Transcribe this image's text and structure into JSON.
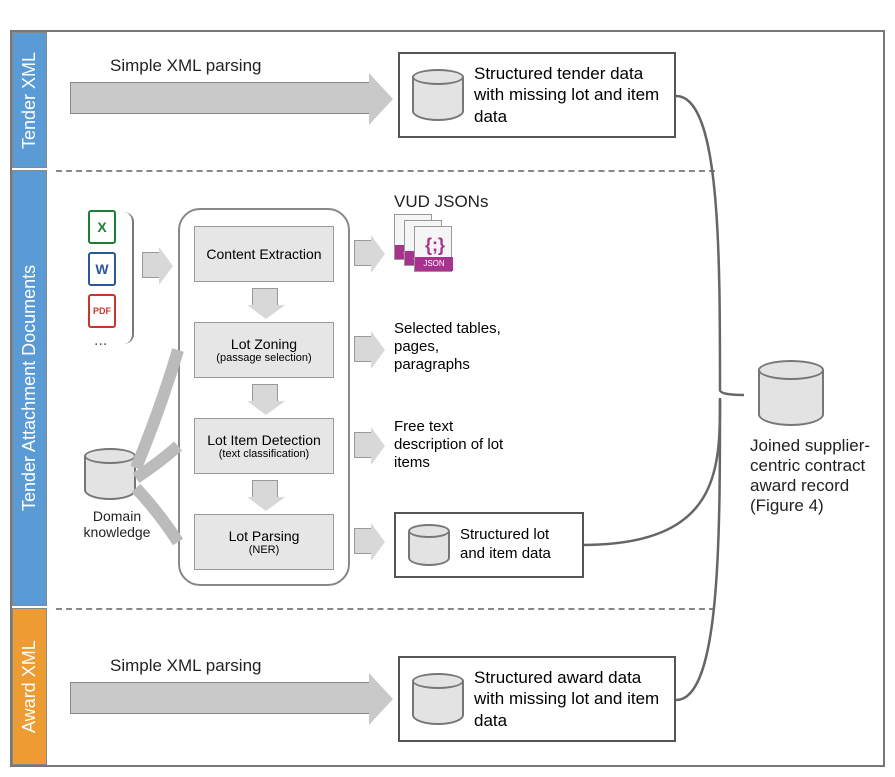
{
  "sections": {
    "tender_xml": "Tender XML",
    "tender_attach": "Tender Attachment Documents",
    "award_xml": "Award XML"
  },
  "arrows": {
    "top_label": "Simple XML parsing",
    "bottom_label": "Simple XML parsing"
  },
  "outputs": {
    "tender_xml": "Structured tender data with missing lot and item data",
    "lot": "Structured lot and item data",
    "award_xml": "Structured award data with missing lot and item data"
  },
  "joined": "Joined supplier-centric contract award record (Figure 4)",
  "pipeline": {
    "header": "VUD JSONs",
    "stages": {
      "content_extraction": {
        "title": "Content Extraction",
        "sub": ""
      },
      "lot_zoning": {
        "title": "Lot Zoning",
        "sub": "(passage selection)"
      },
      "lot_item_detection": {
        "title": "Lot Item Detection",
        "sub": "(text classification)"
      },
      "lot_parsing": {
        "title": "Lot Parsing",
        "sub": "(NER)"
      }
    },
    "stage_outputs": {
      "zoning": "Selected tables, pages, paragraphs",
      "detection": "Free text description of lot items"
    }
  },
  "icons": {
    "excel": "X",
    "word": "W",
    "pdf": "PDF",
    "ellipsis": "...",
    "domain_knowledge": "Domain knowledge",
    "json_label": "JSON"
  }
}
